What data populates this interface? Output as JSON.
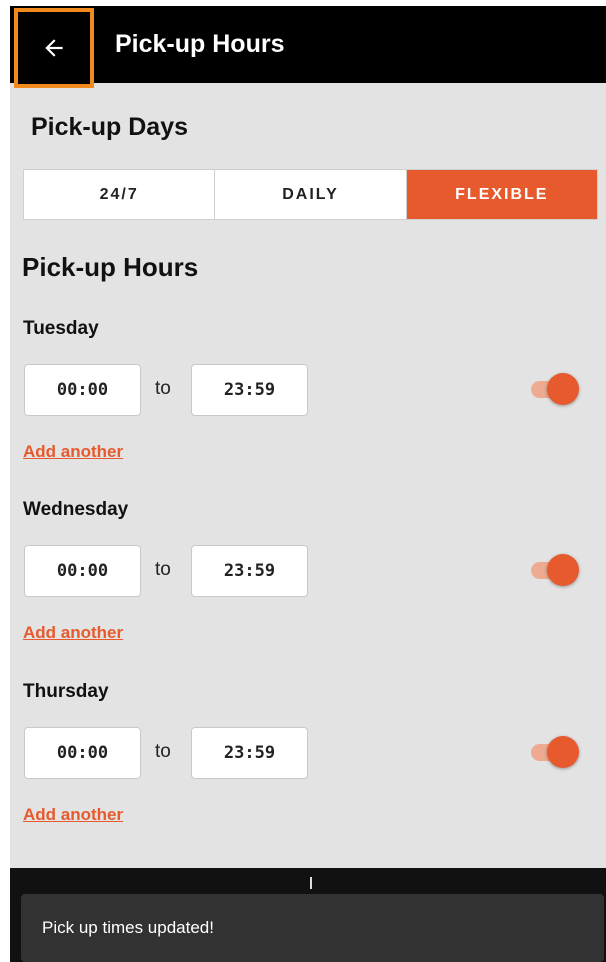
{
  "header": {
    "title": "Pick-up Hours",
    "back_icon": "arrow-left-icon"
  },
  "pickup_days": {
    "title": "Pick-up Days",
    "options": [
      {
        "label": "24/7",
        "selected": false
      },
      {
        "label": "DAILY",
        "selected": false
      },
      {
        "label": "FLEXIBLE",
        "selected": true
      }
    ]
  },
  "pickup_hours": {
    "title": "Pick-up Hours",
    "to_label": "to",
    "add_label": "Add another",
    "days": [
      {
        "name": "Tuesday",
        "from": "00:00",
        "to": "23:59",
        "enabled": true
      },
      {
        "name": "Wednesday",
        "from": "00:00",
        "to": "23:59",
        "enabled": true
      },
      {
        "name": "Thursday",
        "from": "00:00",
        "to": "23:59",
        "enabled": true
      }
    ]
  },
  "snackbar": {
    "message": "Pick up times updated!"
  },
  "colors": {
    "accent": "#e65a2e",
    "focus_outline": "#f28a1e",
    "app_bar": "#000000",
    "background": "#e3e3e3"
  }
}
